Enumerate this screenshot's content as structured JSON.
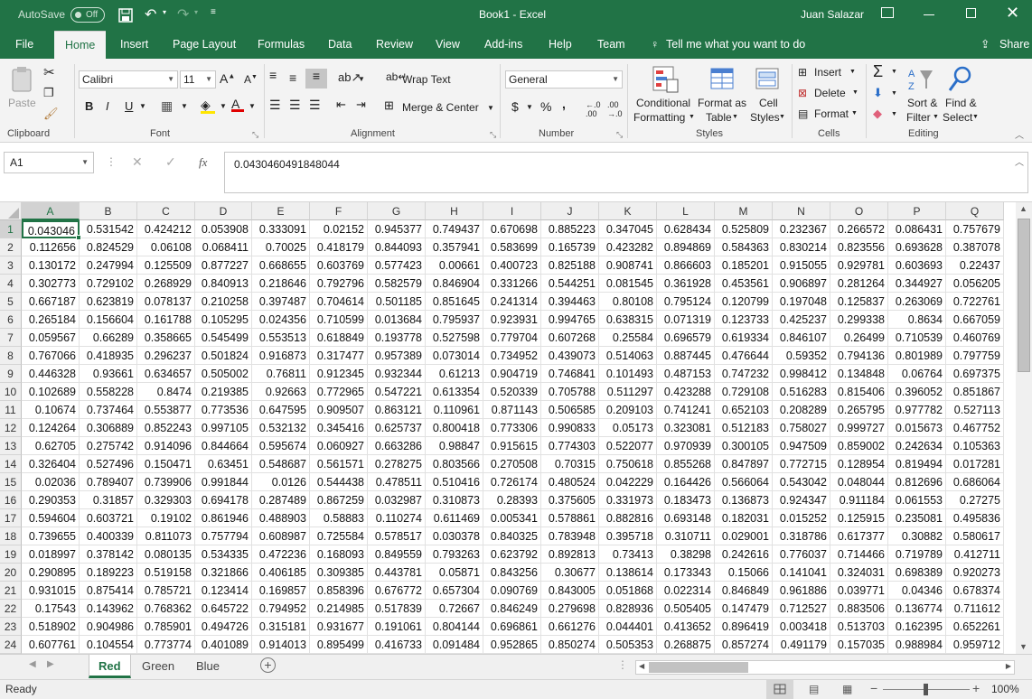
{
  "title_bar": {
    "autosave_label": "AutoSave",
    "autosave_state": "Off",
    "title": "Book1 - Excel",
    "user": "Juan Salazar"
  },
  "tabs": [
    "File",
    "Home",
    "Insert",
    "Page Layout",
    "Formulas",
    "Data",
    "Review",
    "View",
    "Add-ins",
    "Help",
    "Team"
  ],
  "tell_me": "Tell me what you want to do",
  "share": "Share",
  "ribbon": {
    "clipboard": {
      "paste": "Paste",
      "label": "Clipboard"
    },
    "font": {
      "name": "Calibri",
      "size": "11",
      "label": "Font",
      "bold": "B",
      "italic": "I",
      "underline": "U"
    },
    "alignment": {
      "wrap": "Wrap Text",
      "merge": "Merge & Center",
      "label": "Alignment"
    },
    "number": {
      "format": "General",
      "currency": "$",
      "percent": "%",
      "comma": ",",
      "label": "Number"
    },
    "styles": {
      "conditional_1": "Conditional",
      "conditional_2": "Formatting",
      "format_table_1": "Format as",
      "format_table_2": "Table",
      "cell_styles_1": "Cell",
      "cell_styles_2": "Styles",
      "label": "Styles"
    },
    "cells": {
      "insert": "Insert",
      "delete": "Delete",
      "format": "Format",
      "label": "Cells"
    },
    "editing": {
      "sort_1": "Sort &",
      "sort_2": "Filter",
      "find_1": "Find &",
      "find_2": "Select",
      "label": "Editing"
    }
  },
  "formula_bar": {
    "name_box": "A1",
    "fx": "fx",
    "value": "0.0430460491848044"
  },
  "columns": [
    "A",
    "B",
    "C",
    "D",
    "E",
    "F",
    "G",
    "H",
    "I",
    "J",
    "K",
    "L",
    "M",
    "N",
    "O",
    "P",
    "Q"
  ],
  "rows": [
    [
      "0.043046",
      "0.531542",
      "0.424212",
      "0.053908",
      "0.333091",
      "0.02152",
      "0.945377",
      "0.749437",
      "0.670698",
      "0.885223",
      "0.347045",
      "0.628434",
      "0.525809",
      "0.232367",
      "0.266572",
      "0.086431",
      "0.757679"
    ],
    [
      "0.112656",
      "0.824529",
      "0.06108",
      "0.068411",
      "0.70025",
      "0.418179",
      "0.844093",
      "0.357941",
      "0.583699",
      "0.165739",
      "0.423282",
      "0.894869",
      "0.584363",
      "0.830214",
      "0.823556",
      "0.693628",
      "0.387078"
    ],
    [
      "0.130172",
      "0.247994",
      "0.125509",
      "0.877227",
      "0.668655",
      "0.603769",
      "0.577423",
      "0.00661",
      "0.400723",
      "0.825188",
      "0.908741",
      "0.866603",
      "0.185201",
      "0.915055",
      "0.929781",
      "0.603693",
      "0.22437"
    ],
    [
      "0.302773",
      "0.729102",
      "0.268929",
      "0.840913",
      "0.218646",
      "0.792796",
      "0.582579",
      "0.846904",
      "0.331266",
      "0.544251",
      "0.081545",
      "0.361928",
      "0.453561",
      "0.906897",
      "0.281264",
      "0.344927",
      "0.056205"
    ],
    [
      "0.667187",
      "0.623819",
      "0.078137",
      "0.210258",
      "0.397487",
      "0.704614",
      "0.501185",
      "0.851645",
      "0.241314",
      "0.394463",
      "0.80108",
      "0.795124",
      "0.120799",
      "0.197048",
      "0.125837",
      "0.263069",
      "0.722761"
    ],
    [
      "0.265184",
      "0.156604",
      "0.161788",
      "0.105295",
      "0.024356",
      "0.710599",
      "0.013684",
      "0.795937",
      "0.923931",
      "0.994765",
      "0.638315",
      "0.071319",
      "0.123733",
      "0.425237",
      "0.299338",
      "0.8634",
      "0.667059"
    ],
    [
      "0.059567",
      "0.66289",
      "0.358665",
      "0.545499",
      "0.553513",
      "0.618849",
      "0.193778",
      "0.527598",
      "0.779704",
      "0.607268",
      "0.25584",
      "0.696579",
      "0.619334",
      "0.846107",
      "0.26499",
      "0.710539",
      "0.460769"
    ],
    [
      "0.767066",
      "0.418935",
      "0.296237",
      "0.501824",
      "0.916873",
      "0.317477",
      "0.957389",
      "0.073014",
      "0.734952",
      "0.439073",
      "0.514063",
      "0.887445",
      "0.476644",
      "0.59352",
      "0.794136",
      "0.801989",
      "0.797759"
    ],
    [
      "0.446328",
      "0.93661",
      "0.634657",
      "0.505002",
      "0.76811",
      "0.912345",
      "0.932344",
      "0.61213",
      "0.904719",
      "0.746841",
      "0.101493",
      "0.487153",
      "0.747232",
      "0.998412",
      "0.134848",
      "0.06764",
      "0.697375"
    ],
    [
      "0.102689",
      "0.558228",
      "0.8474",
      "0.219385",
      "0.92663",
      "0.772965",
      "0.547221",
      "0.613354",
      "0.520339",
      "0.705788",
      "0.511297",
      "0.423288",
      "0.729108",
      "0.516283",
      "0.815406",
      "0.396052",
      "0.851867"
    ],
    [
      "0.10674",
      "0.737464",
      "0.553877",
      "0.773536",
      "0.647595",
      "0.909507",
      "0.863121",
      "0.110961",
      "0.871143",
      "0.506585",
      "0.209103",
      "0.741241",
      "0.652103",
      "0.208289",
      "0.265795",
      "0.977782",
      "0.527113"
    ],
    [
      "0.124264",
      "0.306889",
      "0.852243",
      "0.997105",
      "0.532132",
      "0.345416",
      "0.625737",
      "0.800418",
      "0.773306",
      "0.990833",
      "0.05173",
      "0.323081",
      "0.512183",
      "0.758027",
      "0.999727",
      "0.015673",
      "0.467752"
    ],
    [
      "0.62705",
      "0.275742",
      "0.914096",
      "0.844664",
      "0.595674",
      "0.060927",
      "0.663286",
      "0.98847",
      "0.915615",
      "0.774303",
      "0.522077",
      "0.970939",
      "0.300105",
      "0.947509",
      "0.859002",
      "0.242634",
      "0.105363"
    ],
    [
      "0.326404",
      "0.527496",
      "0.150471",
      "0.63451",
      "0.548687",
      "0.561571",
      "0.278275",
      "0.803566",
      "0.270508",
      "0.70315",
      "0.750618",
      "0.855268",
      "0.847897",
      "0.772715",
      "0.128954",
      "0.819494",
      "0.017281"
    ],
    [
      "0.02036",
      "0.789407",
      "0.739906",
      "0.991844",
      "0.0126",
      "0.544438",
      "0.478511",
      "0.510416",
      "0.726174",
      "0.480524",
      "0.042229",
      "0.164426",
      "0.566064",
      "0.543042",
      "0.048044",
      "0.812696",
      "0.686064"
    ],
    [
      "0.290353",
      "0.31857",
      "0.329303",
      "0.694178",
      "0.287489",
      "0.867259",
      "0.032987",
      "0.310873",
      "0.28393",
      "0.375605",
      "0.331973",
      "0.183473",
      "0.136873",
      "0.924347",
      "0.911184",
      "0.061553",
      "0.27275"
    ],
    [
      "0.594604",
      "0.603721",
      "0.19102",
      "0.861946",
      "0.488903",
      "0.58883",
      "0.110274",
      "0.611469",
      "0.005341",
      "0.578861",
      "0.882816",
      "0.693148",
      "0.182031",
      "0.015252",
      "0.125915",
      "0.235081",
      "0.495836"
    ],
    [
      "0.739655",
      "0.400339",
      "0.811073",
      "0.757794",
      "0.608987",
      "0.725584",
      "0.578517",
      "0.030378",
      "0.840325",
      "0.783948",
      "0.395718",
      "0.310711",
      "0.029001",
      "0.318786",
      "0.617377",
      "0.30882",
      "0.580617"
    ],
    [
      "0.018997",
      "0.378142",
      "0.080135",
      "0.534335",
      "0.472236",
      "0.168093",
      "0.849559",
      "0.793263",
      "0.623792",
      "0.892813",
      "0.73413",
      "0.38298",
      "0.242616",
      "0.776037",
      "0.714466",
      "0.719789",
      "0.412711"
    ],
    [
      "0.290895",
      "0.189223",
      "0.519158",
      "0.321866",
      "0.406185",
      "0.309385",
      "0.443781",
      "0.05871",
      "0.843256",
      "0.30677",
      "0.138614",
      "0.173343",
      "0.15066",
      "0.141041",
      "0.324031",
      "0.698389",
      "0.920273"
    ],
    [
      "0.931015",
      "0.875414",
      "0.785721",
      "0.123414",
      "0.169857",
      "0.858396",
      "0.676772",
      "0.657304",
      "0.090769",
      "0.843005",
      "0.051868",
      "0.022314",
      "0.846849",
      "0.961886",
      "0.039771",
      "0.04346",
      "0.678374"
    ],
    [
      "0.17543",
      "0.143962",
      "0.768362",
      "0.645722",
      "0.794952",
      "0.214985",
      "0.517839",
      "0.72667",
      "0.846249",
      "0.279698",
      "0.828936",
      "0.505405",
      "0.147479",
      "0.712527",
      "0.883506",
      "0.136774",
      "0.711612"
    ],
    [
      "0.518902",
      "0.904986",
      "0.785901",
      "0.494726",
      "0.315181",
      "0.931677",
      "0.191061",
      "0.804144",
      "0.696861",
      "0.661276",
      "0.044401",
      "0.413652",
      "0.896419",
      "0.003418",
      "0.513703",
      "0.162395",
      "0.652261"
    ],
    [
      "0.607761",
      "0.104554",
      "0.773774",
      "0.401089",
      "0.914013",
      "0.895499",
      "0.416733",
      "0.091484",
      "0.952865",
      "0.850274",
      "0.505353",
      "0.268875",
      "0.857274",
      "0.491179",
      "0.157035",
      "0.988984",
      "0.959712"
    ]
  ],
  "sheets": [
    "Red",
    "Green",
    "Blue"
  ],
  "active_sheet": "Red",
  "status": {
    "ready": "Ready",
    "zoom": "100%"
  },
  "colors": {
    "accent": "#217346"
  }
}
